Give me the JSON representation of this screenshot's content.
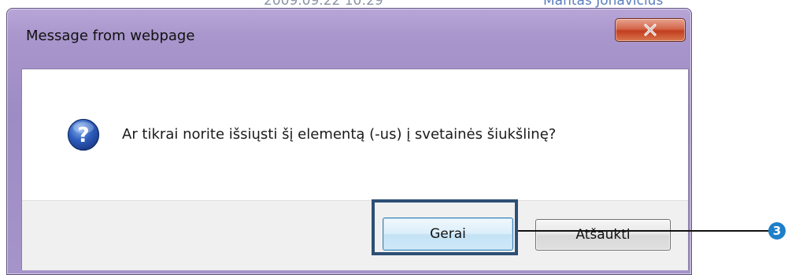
{
  "background": {
    "top_text": "2009.09.22 10:29",
    "top_right_text": "Mantas Jonavičius"
  },
  "dialog": {
    "title": "Message from webpage",
    "close_label": "x",
    "message": "Ar tikrai norite išsiųsti šį elementą (-us) į svetainės šiukšlinę?",
    "icon": "question-icon",
    "buttons": {
      "ok_label": "Gerai",
      "cancel_label": "Atšaukti"
    }
  },
  "callout": {
    "number": "3"
  },
  "colors": {
    "frame": "#a996cc",
    "close_button": "#c23d1f",
    "callout_border": "#2d4f75",
    "badge": "#1f7fc7"
  }
}
